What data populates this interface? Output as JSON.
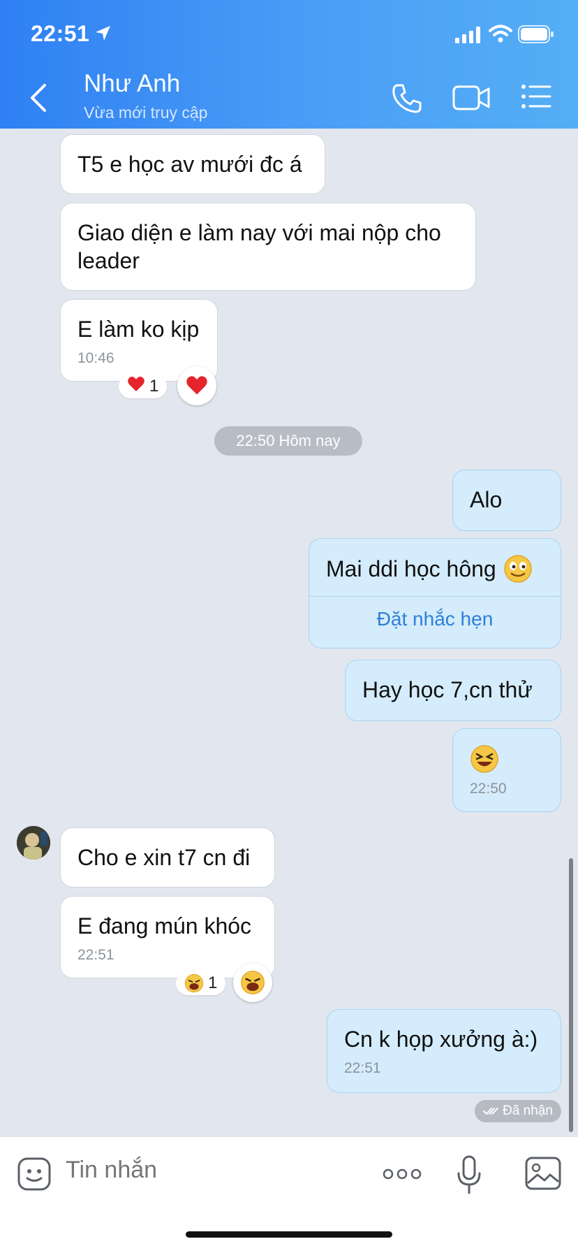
{
  "status_bar": {
    "time": "22:51"
  },
  "header": {
    "name": "Như Anh",
    "status": "Vừa mới truy cập"
  },
  "messages": {
    "m1": "T5 e học av mưới đc á",
    "m2": "Giao diện e làm nay với mai nộp cho leader",
    "m3": "E làm ko kịp",
    "m3_time": "10:46",
    "m3_reaction_count": "1",
    "divider": "22:50 Hôm nay",
    "m4": "Alo",
    "m5": "Mai ddi học hông",
    "m5_action": "Đặt nhắc hẹn",
    "m6": "Hay học 7,cn thử",
    "m7_time": "22:50",
    "m8": "Cho e xin t7 cn đi",
    "m9": "E đang mún khóc",
    "m9_time": "22:51",
    "m9_reaction_count": "1",
    "m10": "Cn k họp xưởng à:)",
    "m10_time": "22:51",
    "delivery_status": "Đã nhận"
  },
  "composer": {
    "placeholder": "Tin nhắn"
  },
  "colors": {
    "header": "#2f80f3",
    "out_bubble": "#d4ecfb",
    "background": "#e2e7ef",
    "link": "#2f80d8"
  }
}
